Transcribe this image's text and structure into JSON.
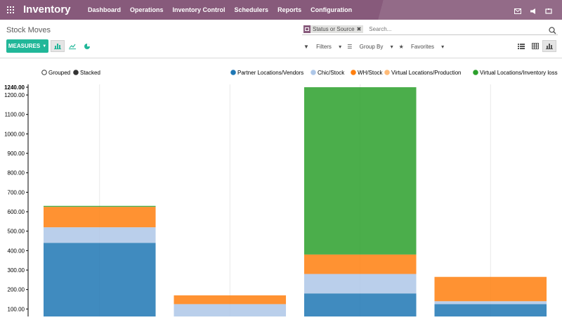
{
  "app": {
    "title": "Inventory"
  },
  "nav": {
    "menus": [
      "Dashboard",
      "Operations",
      "Inventory Control",
      "Schedulers",
      "Reports",
      "Configuration"
    ]
  },
  "page": {
    "breadcrumb": "Stock Moves"
  },
  "search": {
    "facet_value": "Status or Source",
    "placeholder": "Search..."
  },
  "toolbar": {
    "measures_label": "MEASURES",
    "filters_label": "Filters",
    "groupby_label": "Group By",
    "favorites_label": "Favorites"
  },
  "chart_options": {
    "grouped_label": "Grouped",
    "stacked_label": "Stacked",
    "mode": "stacked"
  },
  "chart_data": {
    "type": "bar",
    "stacked": true,
    "categories": [
      "",
      "",
      "",
      ""
    ],
    "series": [
      {
        "name": "Partner Locations/Vendors",
        "color": "#1f77b4",
        "values": [
          440,
          0,
          180,
          125
        ]
      },
      {
        "name": "Chic/Stock",
        "color": "#aec7e8",
        "values": [
          80,
          125,
          100,
          15
        ]
      },
      {
        "name": "WH/Stock",
        "color": "#ff7f0e",
        "values": [
          105,
          45,
          100,
          125
        ]
      },
      {
        "name": "Virtual Locations/Production",
        "color": "#ffbb78",
        "values": [
          0,
          0,
          0,
          0
        ]
      },
      {
        "name": "Virtual Locations/Inventory loss",
        "color": "#2ca02c",
        "values": [
          5,
          0,
          860,
          0
        ]
      }
    ],
    "yticks": [
      "100.00",
      "200.00",
      "300.00",
      "400.00",
      "500.00",
      "600.00",
      "700.00",
      "800.00",
      "900.00",
      "1000.00",
      "1100.00",
      "1200.00",
      "1240.00"
    ],
    "ylim": [
      0,
      1240
    ],
    "legend_position": "top-right",
    "grid": true
  }
}
